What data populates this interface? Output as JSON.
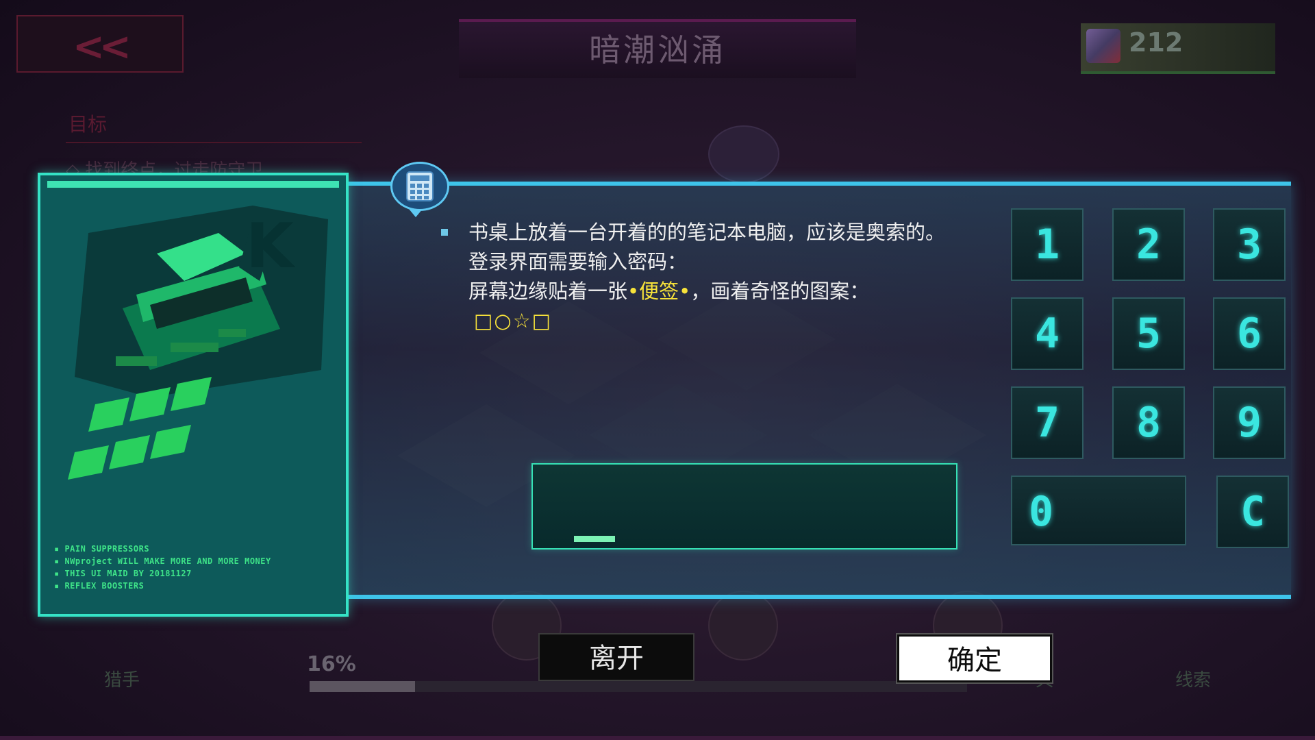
{
  "header": {
    "back_icon": "double-chevron-left-icon",
    "title": "暗潮汹涌",
    "currency_icon": "crystal-cube-icon",
    "currency_amount": "212"
  },
  "objective": {
    "label": "目标",
    "text": "◇ 找到终点，过走防守卫"
  },
  "bottom_hud": {
    "left_label": "猎手",
    "right_label": "线索",
    "mid_label": "具",
    "progress_text": "16%",
    "progress_value": 0.16
  },
  "card": {
    "lines": [
      "PAIN SUPPRESSORS",
      "NWproject WILL MAKE MORE AND MORE MONEY",
      "THIS UI MAID BY 20181127",
      "REFLEX BOOSTERS"
    ]
  },
  "dialog": {
    "icon": "calculator-icon",
    "line1": "书桌上放着一台开着的的笔记本电脑，应该是奥索的。",
    "line2": "登录界面需要输入密码：",
    "line3_pre": "屏幕边缘贴着一张",
    "line3_hl": "•便签•",
    "line3_post": "，画着奇怪的图案：",
    "symbols": "□○☆□",
    "password_value": ""
  },
  "keypad": {
    "k1": "1",
    "k2": "2",
    "k3": "3",
    "k4": "4",
    "k5": "5",
    "k6": "6",
    "k7": "7",
    "k8": "8",
    "k9": "9",
    "k0": "0",
    "kc": "C"
  },
  "buttons": {
    "leave": "离开",
    "confirm": "确定"
  }
}
